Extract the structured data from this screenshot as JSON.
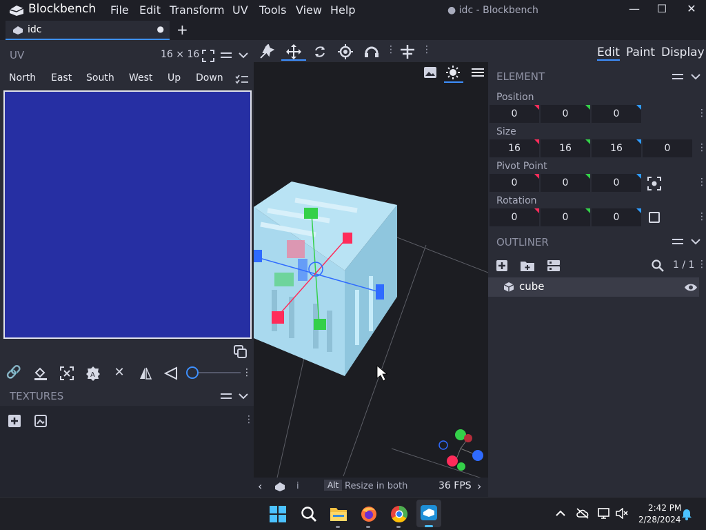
{
  "app": {
    "title": "Blockbench",
    "window_title": "● idc - Blockbench"
  },
  "menu": [
    "File",
    "Edit",
    "Transform",
    "UV",
    "Tools",
    "View",
    "Help"
  ],
  "tabs": [
    {
      "label": "idc",
      "modified": "●"
    }
  ],
  "new_tab": "+",
  "uv": {
    "title": "UV",
    "size": "16 × 16",
    "faces": [
      "North",
      "East",
      "South",
      "West",
      "Up",
      "Down"
    ],
    "canvas_color": "#262fa3"
  },
  "textures": {
    "title": "TEXTURES"
  },
  "viewport": {
    "status": {
      "modifier": "Alt",
      "hint": "Resize in both",
      "fps": "36 FPS",
      "breadcrumb": "i"
    }
  },
  "modes": [
    "Edit",
    "Paint",
    "Display"
  ],
  "element": {
    "title": "ELEMENT",
    "position": {
      "label": "Position",
      "values": [
        "0",
        "0",
        "0"
      ]
    },
    "size": {
      "label": "Size",
      "values": [
        "16",
        "16",
        "16",
        "0"
      ]
    },
    "pivot": {
      "label": "Pivot Point",
      "values": [
        "0",
        "0",
        "0"
      ]
    },
    "rotation": {
      "label": "Rotation",
      "values": [
        "0",
        "0",
        "0"
      ]
    }
  },
  "outliner": {
    "title": "OUTLINER",
    "count": "1 / 1",
    "items": [
      {
        "label": "cube"
      }
    ]
  },
  "taskbar": {
    "time": "2:42 PM",
    "date": "2/28/2024"
  },
  "colors": {
    "accent": "#3e90ff",
    "axis_x": "#ff2c5a",
    "axis_y": "#34d049",
    "axis_z": "#2f9bff",
    "cube": "#a9d9ee"
  }
}
